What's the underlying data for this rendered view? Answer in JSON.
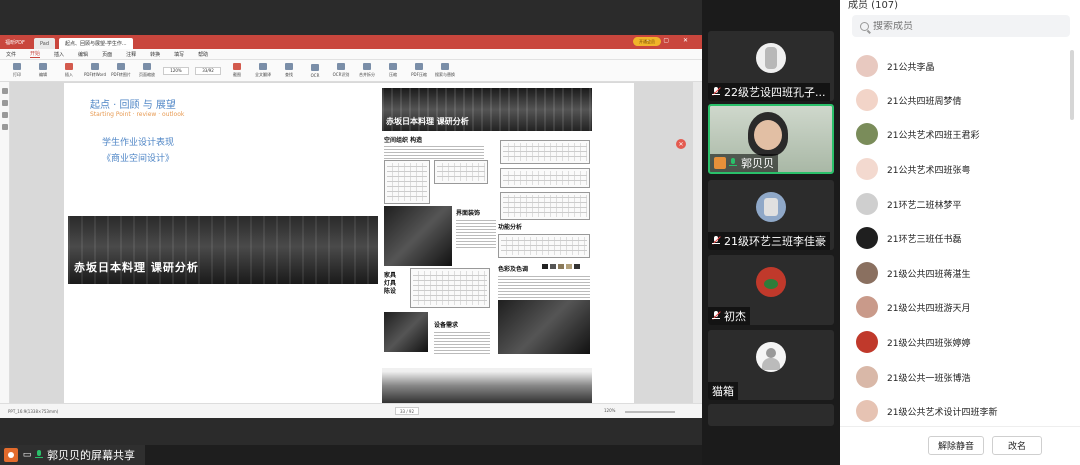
{
  "share": {
    "label": "郭贝贝的屏幕共享",
    "pdf": {
      "app_name": "福昕PDF",
      "tabs": [
        "Pad",
        "起点、回顾与展望-学生作..."
      ],
      "vip_label": "开通会员",
      "menu": [
        "文件",
        "开始",
        "插入",
        "编辑",
        "页面",
        "注释",
        "转换",
        "填写",
        "帮助"
      ],
      "active_menu": "开始",
      "tools": [
        "打印",
        "编辑",
        "插入",
        "PDF转Word",
        "PDF转图片",
        "页面缩放",
        "截图",
        "全文翻译",
        "查找",
        "OCR",
        "OCR识别",
        "合并拆分",
        "压缩",
        "PDF压缩",
        "搜索与替换"
      ],
      "zoom_value": "120%",
      "page_value": "33/92",
      "status_left": "PPT_16:9(1338×753mm)",
      "status_page": "33 / 92",
      "status_zoom": "120%"
    },
    "page": {
      "title": "起点 · 回顾 与 展望",
      "subtitle": "Starting Point · review · outlook",
      "student_work": "学生作业设计表现",
      "course": "《商业空间设计》",
      "banner_text": "赤坂日本料理 课研分析",
      "poster_head": "赤坂日本料理 课研分析",
      "sections": [
        "空间组织 构造",
        "界面装饰",
        "功能分析",
        "家具 灯具 陈设",
        "色彩及色调",
        "设备需求"
      ]
    }
  },
  "videos": [
    {
      "name": "22级艺设四班孔子...",
      "mic": "off",
      "active": false
    },
    {
      "name": "郭贝贝",
      "mic": "on",
      "active": true
    },
    {
      "name": "21级环艺三班李佳豪",
      "mic": "off",
      "active": false
    },
    {
      "name": "初杰",
      "mic": "off",
      "active": false
    },
    {
      "name": "猫箱",
      "mic": "none",
      "active": false
    }
  ],
  "panel": {
    "title": "成员 (107)",
    "search_placeholder": "搜索成员",
    "members": [
      "21公共李晶",
      "21公共四班周梦倩",
      "21公共艺术四班王君彩",
      "21公共艺术四班张粤",
      "21环艺二班林梦平",
      "21环艺三班任书磊",
      "21级公共四班蒋湛生",
      "21级公共四班游天月",
      "21级公共四班张婷婷",
      "21级公共一班张博浩",
      "21级公共艺术设计四班李新"
    ],
    "unmute_all": "解除静音",
    "rename": "改名"
  },
  "colors": {
    "accent_red": "#c9463d",
    "title_blue": "#4f86c6",
    "subtitle_orange": "#e79a52",
    "active_green": "#2ac06a"
  }
}
